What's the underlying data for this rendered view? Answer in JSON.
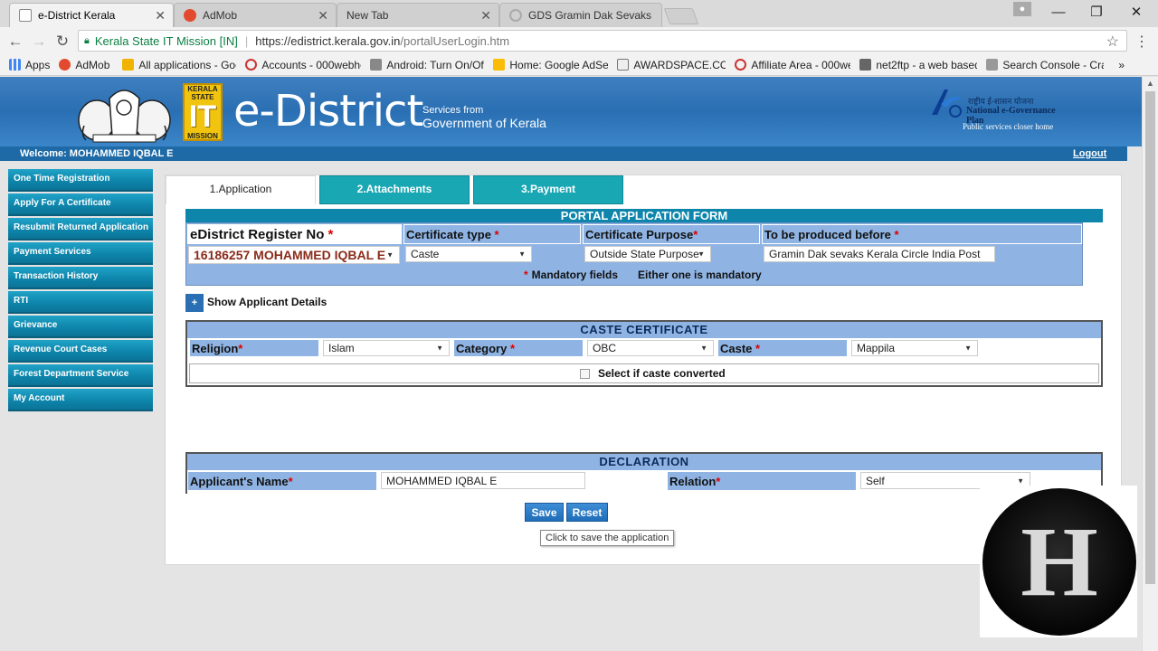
{
  "browser": {
    "tabs": [
      {
        "title": "e-District Kerala",
        "active": true
      },
      {
        "title": "AdMob",
        "active": false
      },
      {
        "title": "New Tab",
        "active": false
      },
      {
        "title": "GDS Gramin Dak Sevaks",
        "active": false
      }
    ],
    "address": {
      "secure_label": "Kerala State IT Mission [IN]",
      "url_host": "https://edistrict.kerala.gov.in",
      "url_path": "/portalUserLogin.htm"
    },
    "bookmarks": [
      "Apps",
      "AdMob",
      "All applications - Goo",
      "Accounts - 000webho",
      "Android: Turn On/Off",
      "Home: Google AdSen",
      "AWARDSPACE.COM",
      "Affiliate Area - 000we",
      "net2ftp - a web based",
      "Search Console - Cra"
    ],
    "more_bookmarks": "»"
  },
  "banner": {
    "itm_top": "KERALA STATE",
    "itm_letters": "IT",
    "itm_bottom": "MISSION",
    "brand": "e-District",
    "services_from": "Services from",
    "government": "Government of Kerala",
    "negp_hindi": "राष्ट्रीय ई-शासन योजना",
    "negp_name": "National e-Governance Plan",
    "negp_tagline": "Public services closer home"
  },
  "welcome": {
    "text": "Welcome: MOHAMMED IQBAL E",
    "logout": "Logout"
  },
  "sidebar": {
    "items": [
      "One Time Registration",
      "Apply For A Certificate",
      "Resubmit Returned Application",
      "Payment Services",
      "Transaction History",
      "RTI",
      "Grievance",
      "Revenue Court Cases",
      "Forest Department Service",
      "My Account"
    ]
  },
  "steps": {
    "tab1": "1.Application",
    "tab2": "2.Attachments",
    "tab3": "3.Payment"
  },
  "form": {
    "title": "PORTAL APPLICATION FORM",
    "reg_label": "eDistrict Register No",
    "cert_type_label": "Certificate type",
    "purpose_label": "Certificate Purpose",
    "produced_label": "To be produced before",
    "reg_value": "16186257 MOHAMMED IQBAL E",
    "cert_type_value": "Caste",
    "purpose_value": "Outside State Purpose",
    "produced_value": "Gramin Dak sevaks Kerala Circle India Post",
    "mandatory_text": "Mandatory fields",
    "either_text": "Either one is mandatory",
    "asterisk": "*",
    "show_details_label": "Show Applicant Details",
    "plus_icon": "+"
  },
  "caste": {
    "title": "CASTE CERTIFICATE",
    "religion_label": "Religion",
    "religion_value": "Islam",
    "category_label": "Category",
    "category_value": "OBC",
    "caste_label": "Caste",
    "caste_value": "Mappila",
    "converted_label": "Select if caste converted",
    "converted_checked": false
  },
  "declaration": {
    "title": "DECLARATION",
    "name_label": "Applicant's Name",
    "name_value": "MOHAMMED IQBAL E",
    "relation_label": "Relation",
    "relation_value": "Self"
  },
  "actions": {
    "save": "Save",
    "reset": "Reset",
    "tooltip": "Click to save the application"
  },
  "watermark": {
    "letter": "H"
  }
}
